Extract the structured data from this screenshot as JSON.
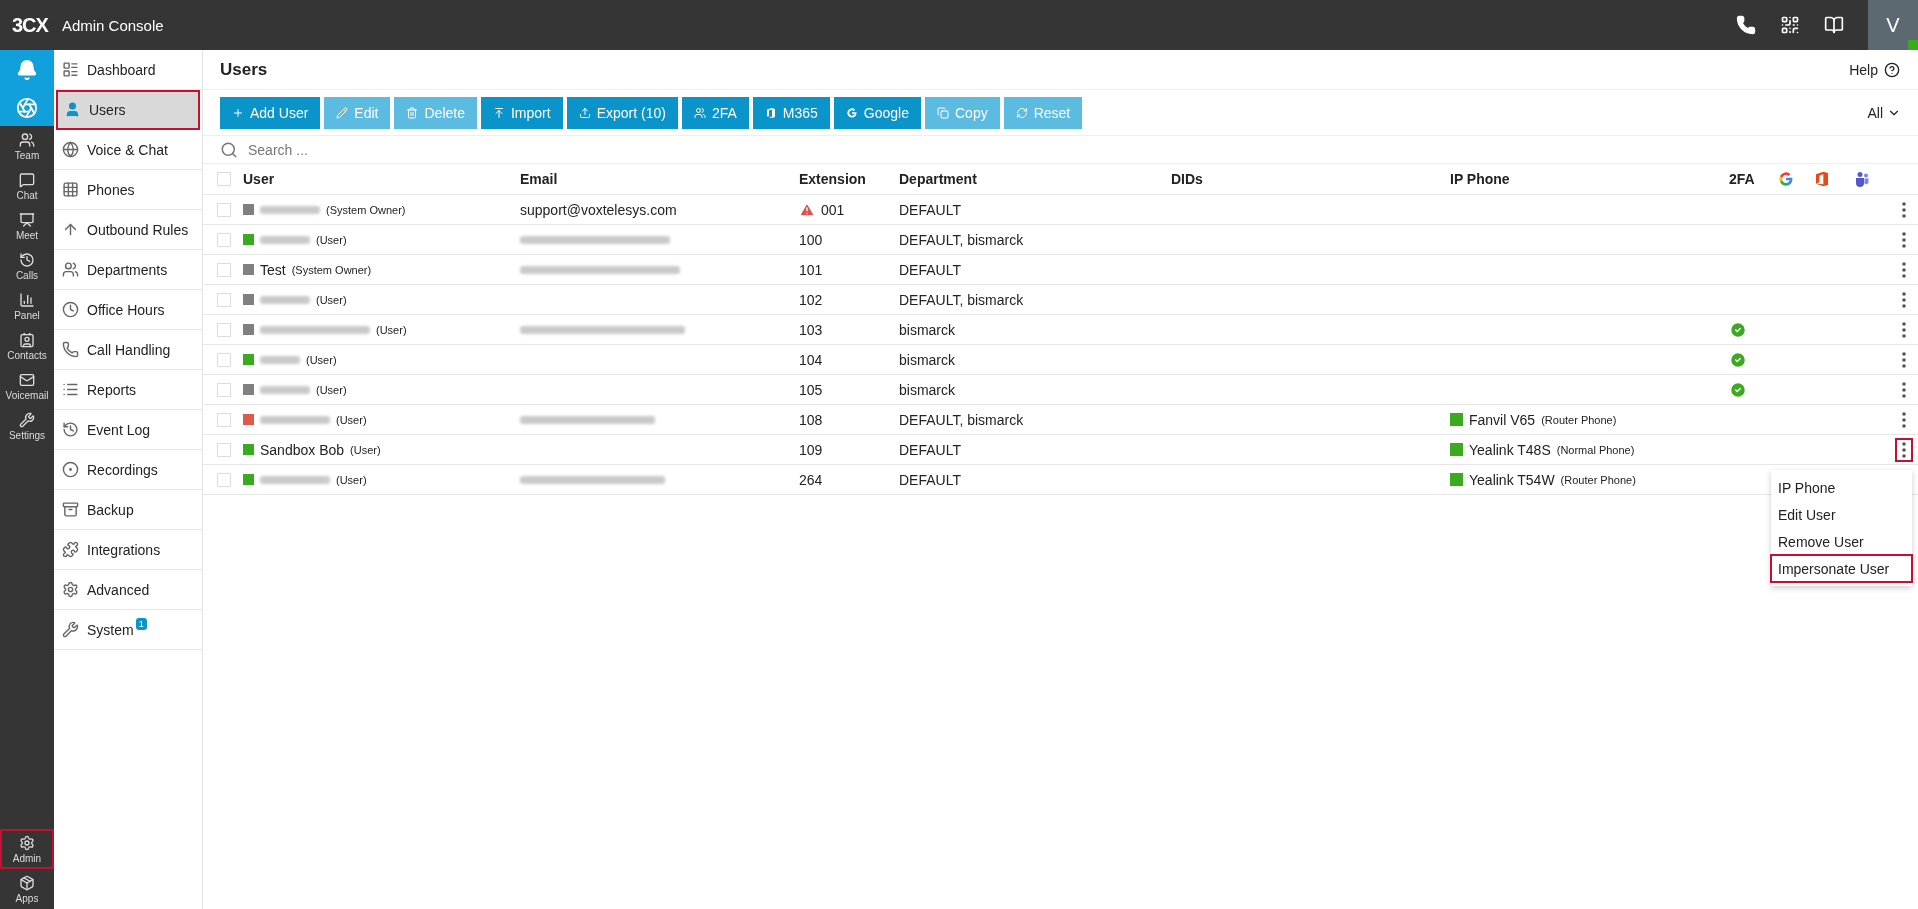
{
  "topbar": {
    "logo": "3CX",
    "title": "Admin Console",
    "avatar": "V",
    "avatar_online": true
  },
  "rail": {
    "top": [
      {
        "kind": "bell",
        "selected": true
      },
      {
        "kind": "browser",
        "selected": true
      }
    ],
    "items": [
      {
        "kind": "team",
        "label": "Team"
      },
      {
        "kind": "chat",
        "label": "Chat"
      },
      {
        "kind": "meet",
        "label": "Meet"
      },
      {
        "kind": "calls",
        "label": "Calls"
      },
      {
        "kind": "panel",
        "label": "Panel"
      },
      {
        "kind": "contacts",
        "label": "Contacts"
      },
      {
        "kind": "voicemail",
        "label": "Voicemail"
      },
      {
        "kind": "settings",
        "label": "Settings"
      }
    ],
    "bottom": [
      {
        "kind": "admin",
        "label": "Admin",
        "highlighted": true
      },
      {
        "kind": "apps",
        "label": "Apps",
        "highlighted": false
      }
    ]
  },
  "nav": [
    {
      "kind": "dashboard",
      "label": "Dashboard",
      "selected": false,
      "highlighted": false
    },
    {
      "kind": "users",
      "label": "Users",
      "selected": true,
      "highlighted": true
    },
    {
      "kind": "voice",
      "label": "Voice & Chat",
      "selected": false,
      "highlighted": false
    },
    {
      "kind": "phones",
      "label": "Phones",
      "selected": false,
      "highlighted": false
    },
    {
      "kind": "outbound",
      "label": "Outbound Rules",
      "selected": false,
      "highlighted": false
    },
    {
      "kind": "departments",
      "label": "Departments",
      "selected": false,
      "highlighted": false
    },
    {
      "kind": "hours",
      "label": "Office Hours",
      "selected": false,
      "highlighted": false
    },
    {
      "kind": "handling",
      "label": "Call Handling",
      "selected": false,
      "highlighted": false
    },
    {
      "kind": "reports",
      "label": "Reports",
      "selected": false,
      "highlighted": false
    },
    {
      "kind": "eventlog",
      "label": "Event Log",
      "selected": false,
      "highlighted": false
    },
    {
      "kind": "recordings",
      "label": "Recordings",
      "selected": false,
      "highlighted": false
    },
    {
      "kind": "backup",
      "label": "Backup",
      "selected": false,
      "highlighted": false
    },
    {
      "kind": "integrations",
      "label": "Integrations",
      "selected": false,
      "highlighted": false
    },
    {
      "kind": "advanced",
      "label": "Advanced",
      "selected": false,
      "highlighted": false
    },
    {
      "kind": "system",
      "label": "System",
      "badge": "1",
      "selected": false,
      "highlighted": false
    }
  ],
  "page": {
    "title": "Users",
    "help": "Help",
    "filter": "All"
  },
  "toolbar": [
    {
      "kind": "add",
      "label": "Add User",
      "disabled": false
    },
    {
      "kind": "edit",
      "label": "Edit",
      "disabled": true
    },
    {
      "kind": "delete",
      "label": "Delete",
      "disabled": true
    },
    {
      "kind": "import",
      "label": "Import",
      "disabled": false
    },
    {
      "kind": "export",
      "label": "Export (10)",
      "disabled": false
    },
    {
      "kind": "twofa",
      "label": "2FA",
      "disabled": false
    },
    {
      "kind": "m365",
      "label": "M365",
      "disabled": false
    },
    {
      "kind": "google",
      "label": "Google",
      "disabled": false
    },
    {
      "kind": "copy",
      "label": "Copy",
      "disabled": true
    },
    {
      "kind": "reset",
      "label": "Reset",
      "disabled": true
    }
  ],
  "search": {
    "placeholder": "Search ..."
  },
  "table": {
    "select_all_checked": false,
    "columns": [
      "User",
      "Email",
      "Extension",
      "Department",
      "DIDs",
      "IP Phone",
      "2FA"
    ],
    "rows": [
      {
        "checked": false,
        "color": "#808080",
        "role": "(System Owner)",
        "email": "support@voxtelesys.com",
        "extension": "001",
        "warning": true,
        "department": "DEFAULT",
        "two_fa": false,
        "menu_highlighted": false
      },
      {
        "checked": false,
        "color": "#3aaa1f",
        "role": "(User)",
        "extension": "100",
        "warning": false,
        "department": "DEFAULT, bismarck",
        "two_fa": false,
        "menu_highlighted": false
      },
      {
        "checked": false,
        "color": "#808080",
        "name": "Test",
        "role": "(System Owner)",
        "extension": "101",
        "warning": false,
        "department": "DEFAULT",
        "two_fa": false,
        "menu_highlighted": false
      },
      {
        "checked": false,
        "color": "#808080",
        "role": "(User)",
        "extension": "102",
        "warning": false,
        "department": "DEFAULT, bismarck",
        "two_fa": false,
        "menu_highlighted": false
      },
      {
        "checked": false,
        "color": "#808080",
        "role": "(User)",
        "extension": "103",
        "warning": false,
        "department": "bismarck",
        "two_fa": true,
        "menu_highlighted": false
      },
      {
        "checked": false,
        "color": "#3aaa1f",
        "role": "(User)",
        "extension": "104",
        "warning": false,
        "department": "bismarck",
        "two_fa": true,
        "menu_highlighted": false
      },
      {
        "checked": false,
        "color": "#808080",
        "role": "(User)",
        "extension": "105",
        "warning": false,
        "department": "bismarck",
        "two_fa": true,
        "menu_highlighted": false
      },
      {
        "checked": false,
        "color": "#e05a4a",
        "role": "(User)",
        "extension": "108",
        "warning": false,
        "department": "DEFAULT, bismarck",
        "two_fa": false,
        "phone": {
          "model": "Fanvil V65",
          "type": "(Router Phone)",
          "color": "#3aaa1f"
        },
        "menu_highlighted": false
      },
      {
        "checked": false,
        "color": "#3aaa1f",
        "name": "Sandbox Bob",
        "role": "(User)",
        "extension": "109",
        "warning": false,
        "department": "DEFAULT",
        "two_fa": false,
        "phone": {
          "model": "Yealink T48S",
          "type": "(Normal Phone)",
          "color": "#3aaa1f"
        },
        "menu_highlighted": true,
        "menu": [
          {
            "label": "IP Phone",
            "highlighted": false
          },
          {
            "label": "Edit User",
            "highlighted": false
          },
          {
            "label": "Remove User",
            "highlighted": false
          },
          {
            "label": "Impersonate User",
            "highlighted": true
          }
        ]
      },
      {
        "checked": false,
        "color": "#3aaa1f",
        "role": "(User)",
        "extension": "264",
        "warning": false,
        "department": "DEFAULT",
        "two_fa": false,
        "phone": {
          "model": "Yealink T54W",
          "type": "(Router Phone)",
          "color": "#3aaa1f"
        }
      }
    ]
  }
}
